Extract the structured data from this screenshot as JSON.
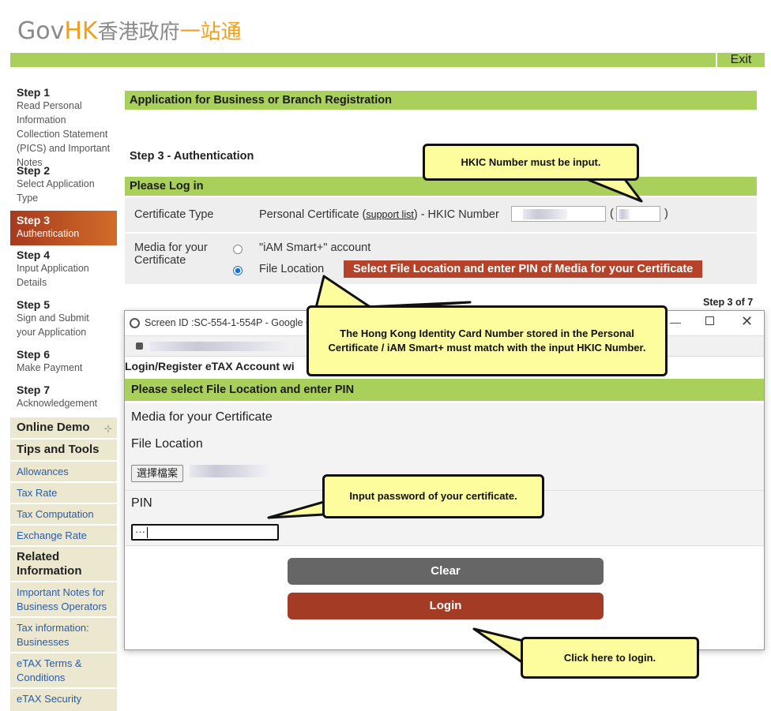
{
  "header": {
    "logo_gov": "Gov",
    "logo_hk": "HK",
    "logo_zh1": "香港政府",
    "logo_zh2": "一站通",
    "exit_label": "Exit"
  },
  "sidebar": {
    "steps": [
      {
        "title": "Step 1",
        "desc": "Read Personal Information Collection Statement (PICS) and Important Notes"
      },
      {
        "title": "Step 2",
        "desc": "Select Application Type"
      },
      {
        "title": "Step 3",
        "desc": "Authentication"
      },
      {
        "title": "Step 4",
        "desc": "Input Application Details"
      },
      {
        "title": "Step 5",
        "desc": "Sign and Submit your Application"
      },
      {
        "title": "Step 6",
        "desc": "Make Payment"
      },
      {
        "title": "Step 7",
        "desc": "Acknowledgement"
      }
    ],
    "online_demo": "Online Demo",
    "tips_tools": "Tips and Tools",
    "tips_links": [
      "Allowances",
      "Tax Rate",
      "Tax Computation",
      "Exchange Rate"
    ],
    "related_info": "Related Information",
    "related_links": [
      "Important Notes for Business Operators",
      "Tax information: Businesses",
      "eTAX Terms & Conditions",
      "eTAX Security"
    ]
  },
  "main": {
    "page_title": "Application for Business or Branch Registration",
    "step_heading": "Step 3 - Authentication",
    "login_heading": "Please Log in",
    "cert_type_label": "Certificate Type",
    "cert_type_value": "Personal Certificate (",
    "support_list": "support list",
    "cert_type_suffix": ") - HKIC Number",
    "paren_open": "(",
    "paren_close": ")",
    "media_label": "Media for your Certificate",
    "option_iam": "\"iAM Smart+\" account",
    "option_file": "File Location",
    "select_file_banner": "Select File Location and enter PIN of Media for your Certificate",
    "step_counter": "Step 3 of 7"
  },
  "popup": {
    "window_title": "Screen ID :SC-554-1-554P - Google C",
    "content_title": "Login/Register eTAX Account wi",
    "section_heading": "Please select File Location and enter PIN",
    "media_label": "Media for your Certificate",
    "file_location_label": "File Location",
    "choose_file_button": "選擇檔案",
    "pin_label": "PIN",
    "pin_value": "···",
    "clear_button": "Clear",
    "login_button": "Login"
  },
  "callouts": {
    "hkic": "HKIC Number must be input.",
    "match": "The Hong Kong Identity Card Number stored in the Personal Certificate / iAM Smart+ must match with the input HKIC Number.",
    "password": "Input password of your certificate.",
    "login": "Click here to login."
  },
  "colors": {
    "green_bar": "#a8d05a",
    "active_step": "#b5432a",
    "callout_fill": "#fdfd9d",
    "link": "#2a5ca8"
  }
}
